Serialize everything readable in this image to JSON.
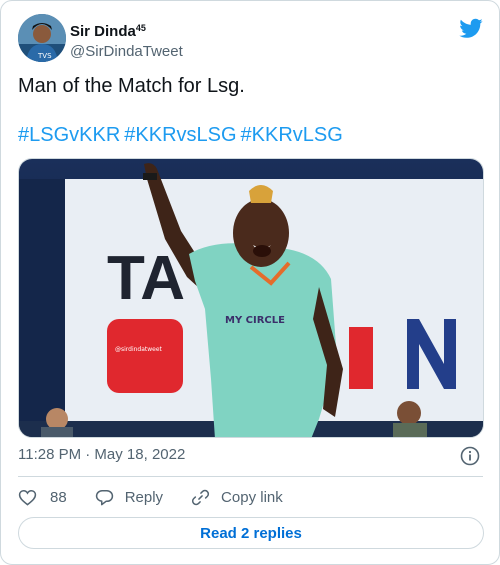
{
  "tweet": {
    "author": {
      "name": "Sir Dinda",
      "name_sup": "45",
      "handle": "@SirDindaTweet"
    },
    "text": "Man of the Match for Lsg.",
    "hashtags": [
      "#LSGvKKR",
      "#KKRvsLSG",
      "#KKRvLSG"
    ],
    "media": {
      "board_text": "TA",
      "jersey_text": "MY CIRCLE",
      "watermark": "@sirdindatweet"
    },
    "timestamp": "11:28 PM · May 18, 2022",
    "likes": "88",
    "reply_label": "Reply",
    "copy_link_label": "Copy link",
    "read_replies_label": "Read 2 replies"
  },
  "colors": {
    "accent": "#1d9bf0",
    "link": "#006fd6",
    "muted": "#536471",
    "border": "#cfd9de"
  },
  "icons": [
    "twitter-bird-icon",
    "info-icon",
    "heart-icon",
    "reply-icon",
    "link-icon"
  ]
}
